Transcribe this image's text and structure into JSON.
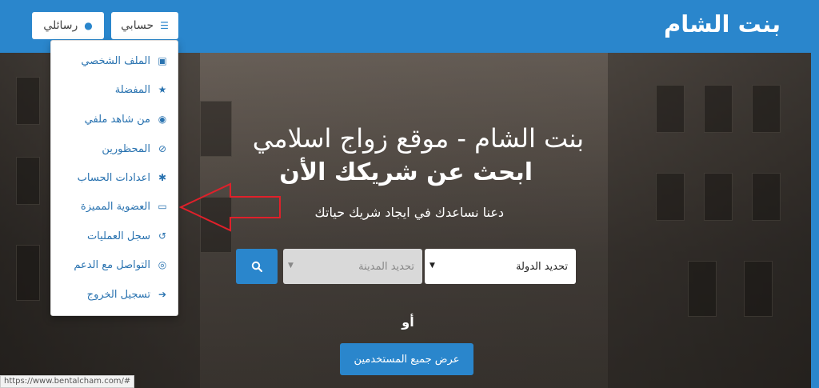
{
  "header": {
    "brand": "بنت الشام",
    "account_label": "حسابي",
    "messages_label": "رسائلي",
    "account_icon": "list-icon",
    "messages_icon": "chat-icon"
  },
  "dropdown": {
    "items": [
      {
        "label": "الملف الشخصي",
        "icon": "id-card-icon",
        "glyph": "▣"
      },
      {
        "label": "المفضلة",
        "icon": "star-icon",
        "glyph": "★"
      },
      {
        "label": "من شاهد ملفي",
        "icon": "eye-icon",
        "glyph": "◉"
      },
      {
        "label": "المحظورين",
        "icon": "ban-icon",
        "glyph": "⊘"
      },
      {
        "label": "اعدادات الحساب",
        "icon": "gear-icon",
        "glyph": "✱"
      },
      {
        "label": "العضوية المميزة",
        "icon": "credit-card-icon",
        "glyph": "▭"
      },
      {
        "label": "سجل العمليات",
        "icon": "history-icon",
        "glyph": "↺"
      },
      {
        "label": "التواصل مع الدعم",
        "icon": "lifebuoy-icon",
        "glyph": "◎"
      },
      {
        "label": "تسجيل الخروج",
        "icon": "sign-out-icon",
        "glyph": "➔"
      }
    ]
  },
  "hero": {
    "title": "بنت الشام - موقع زواج اسلامي",
    "subtitle": "ابحث عن شريكك الأن",
    "tagline": "دعنا نساعدك في ايجاد شريك حياتك"
  },
  "search": {
    "country_value": "تحديد الدولة",
    "city_placeholder": "تحديد المدينة",
    "search_icon": "search-icon",
    "or_text": "أو",
    "all_users_label": "عرض جميع المستخدمين"
  },
  "status": {
    "url": "https://www.bentalcham.com/#"
  },
  "colors": {
    "primary": "#2a86cc",
    "annotation_arrow": "#e0202a"
  }
}
